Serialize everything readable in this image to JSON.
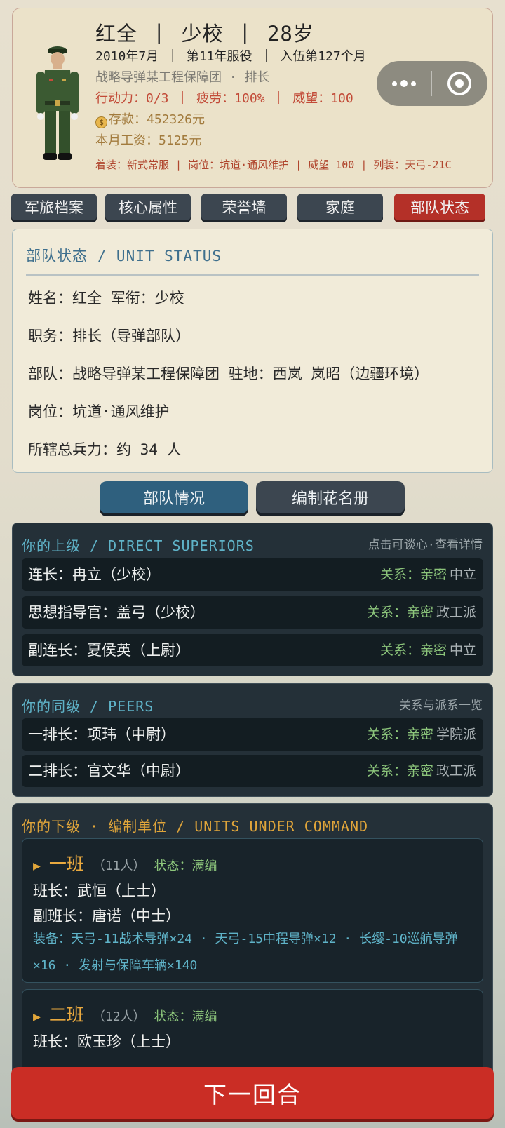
{
  "profile": {
    "name": "红全",
    "rank": "少校",
    "age": "28岁",
    "line2": "2010年7月 ｜ 第11年服役 ｜ 入伍第127个月",
    "unit_line": "战略导弹某工程保障团 · 排长",
    "stats_line": "行动力：0/3 ｜ 疲劳：100% ｜ 威望：100",
    "savings": "存款：452326元",
    "salary": "本月工资：5125元",
    "footer": "着装：新式常服 | 岗位：坑道·通风维护 | 威望 100 | 列装：天弓-21C",
    "coin_icon": "$"
  },
  "main_tabs": [
    "军旅档案",
    "核心属性",
    "荣誉墙",
    "家庭",
    "部队状态"
  ],
  "status": {
    "heading": "部队状态 / UNIT STATUS",
    "lines": [
      "姓名：红全  军衔：少校",
      "职务：排长（导弹部队）",
      "部队：战略导弹某工程保障团  驻地：西岚 岚昭（边疆环境）",
      "岗位：坑道·通风维护",
      "所辖总兵力：约 34 人"
    ]
  },
  "sub_tabs": [
    "部队情况",
    "编制花名册"
  ],
  "superiors": {
    "heading": "你的上级 / DIRECT SUPERIORS",
    "hint": "点击可谈心·查看详情",
    "rows": [
      {
        "name": "连长：冉立（少校）",
        "rel": "关系：亲密",
        "faction": "中立"
      },
      {
        "name": "思想指导官：盖弓（少校）",
        "rel": "关系：亲密",
        "faction": "政工派"
      },
      {
        "name": "副连长：夏侯英（上尉）",
        "rel": "关系：亲密",
        "faction": "中立"
      }
    ]
  },
  "peers": {
    "heading": "你的同级 / PEERS",
    "hint": "关系与派系一览",
    "rows": [
      {
        "name": "一排长：项玮（中尉）",
        "rel": "关系：亲密",
        "faction": "学院派"
      },
      {
        "name": "二排长：官文华（中尉）",
        "rel": "关系：亲密",
        "faction": "政工派"
      }
    ]
  },
  "command": {
    "heading": "你的下级 · 编制单位 / UNITS UNDER COMMAND",
    "units": [
      {
        "name": "一班",
        "count": "（11人）",
        "state": "状态：满编",
        "leader": "班长：武恒（上士）",
        "deputy": "副班长：唐诺（中士）",
        "equipment": "装备：天弓-11战术导弹×24 · 天弓-15中程导弹×12 · 长缨-10巡航导弹×16 · 发射与保障车辆×140"
      },
      {
        "name": "二班",
        "count": "（12人）",
        "state": "状态：满编",
        "leader": "班长：欧玉珍（上士）"
      }
    ]
  },
  "next_button": "下一回合",
  "colors": {
    "accent_red": "#ca2d25",
    "active_tab": "#b43028",
    "panel_dark": "#243038",
    "cyan_text": "#5fb3c8",
    "relation_green": "#8cc57b",
    "unit_gold": "#e9a93f"
  }
}
